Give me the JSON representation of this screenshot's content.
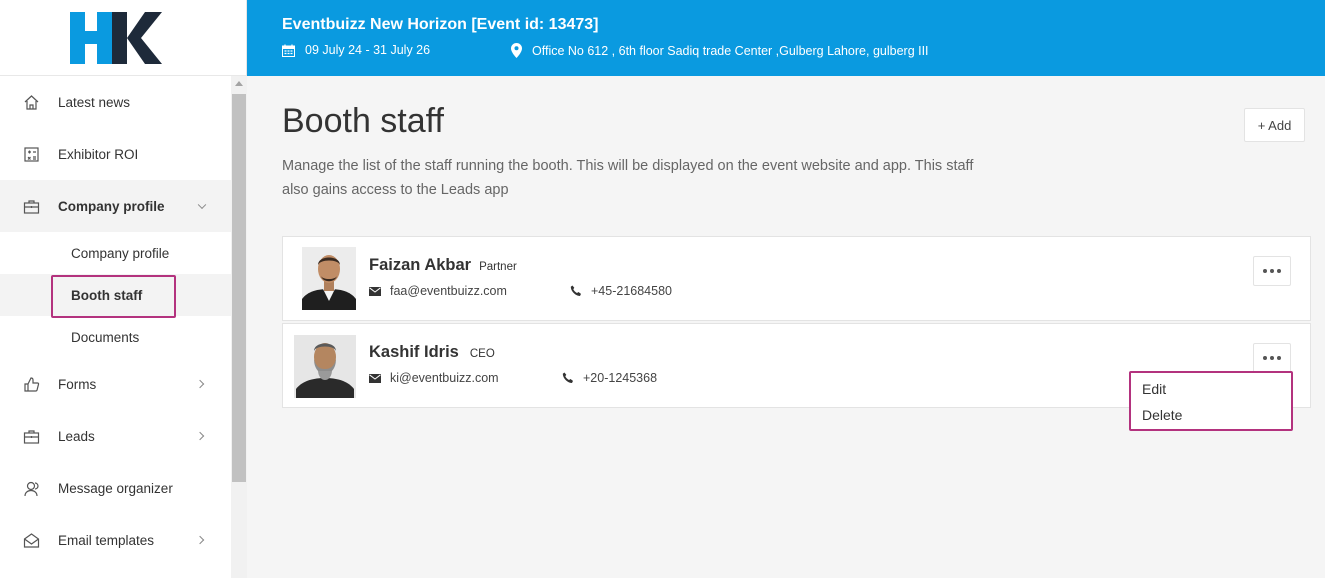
{
  "brand": {
    "logo_text": "HK",
    "colors": {
      "blue": "#0a9ae0",
      "dark": "#1e2a3a",
      "highlight": "#b3327e"
    }
  },
  "sidebar": {
    "items": [
      {
        "label": "Latest news",
        "icon": "home-icon"
      },
      {
        "label": "Exhibitor ROI",
        "icon": "calculator-icon"
      },
      {
        "label": "Company profile",
        "icon": "briefcase-icon",
        "expanded": true,
        "children": [
          {
            "label": "Company profile"
          },
          {
            "label": "Booth staff",
            "selected": true
          },
          {
            "label": "Documents"
          }
        ]
      },
      {
        "label": "Forms",
        "icon": "thumbs-up-icon"
      },
      {
        "label": "Leads",
        "icon": "briefcase-icon"
      },
      {
        "label": "Message organizer",
        "icon": "users-icon"
      },
      {
        "label": "Email templates",
        "icon": "envelope-open-icon"
      }
    ]
  },
  "header": {
    "title": "Eventbuizz New Horizon [Event id: 13473]",
    "date": "09 July 24 - 31 July 26",
    "address": "Office No 612 , 6th floor Sadiq trade Center ,Gulberg Lahore, gulberg III"
  },
  "main": {
    "title": "Booth staff",
    "description": "Manage the list of the staff running the booth. This will be displayed on the event website and app. This staff also gains access to the Leads app",
    "add_label": "+ Add",
    "staff": [
      {
        "name": "Faizan Akbar",
        "role": "Partner",
        "email": "faa@eventbuizz.com",
        "phone": "+45-21684580"
      },
      {
        "name": "Kashif Idris",
        "role": "CEO",
        "email": "ki@eventbuizz.com",
        "phone": "+20-1245368"
      }
    ],
    "menu": {
      "edit_label": "Edit",
      "delete_label": "Delete"
    }
  }
}
